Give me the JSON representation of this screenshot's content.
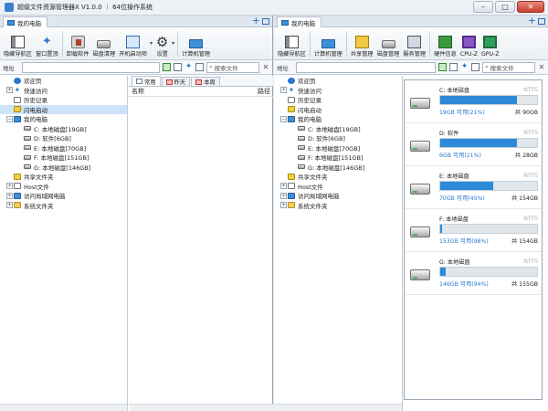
{
  "window": {
    "title": "超级文件资源管理器X V1.0.0 ｜ 64位操作系统"
  },
  "left": {
    "tab_label": "我的电脑",
    "ribbon": [
      "隐藏导航区",
      "窗口置顶",
      "卸载软件",
      "磁盘清理",
      "开机启动项",
      "设置",
      "计算机管理"
    ],
    "address_label": "地址",
    "search_placeholder": "搜索文件",
    "file_tabs": [
      "常用",
      "昨天",
      "本周"
    ],
    "columns": {
      "name": "名称",
      "path": "路径"
    }
  },
  "right": {
    "tab_label": "我的电脑",
    "ribbon": [
      "隐藏导航区",
      "计算机管理",
      "共享管理",
      "磁盘管理",
      "服务管理",
      "硬件信息",
      "CPU-Z",
      "GPU-Z"
    ],
    "address_label": "地址",
    "search_placeholder": "搜索文件"
  },
  "tree": [
    {
      "label": "欢迎页",
      "icon": "globe",
      "exp": ""
    },
    {
      "label": "快速访问",
      "icon": "star",
      "exp": "+"
    },
    {
      "label": "历史记录",
      "icon": "doc",
      "exp": ""
    },
    {
      "label": "闪电启动",
      "icon": "flash",
      "exp": ""
    },
    {
      "label": "我的电脑",
      "icon": "pc",
      "exp": "−"
    },
    {
      "label": "C: 本地磁盘[19GB]",
      "icon": "drv",
      "exp": "",
      "indent": 1
    },
    {
      "label": "D: 软件[6GB]",
      "icon": "drv",
      "exp": "",
      "indent": 1
    },
    {
      "label": "E: 本地磁盘[70GB]",
      "icon": "drv",
      "exp": "",
      "indent": 1
    },
    {
      "label": "F: 本地磁盘[151GB]",
      "icon": "drv",
      "exp": "",
      "indent": 1
    },
    {
      "label": "G: 本地磁盘[146GB]",
      "icon": "drv",
      "exp": "",
      "indent": 1
    },
    {
      "label": "共享文件夹",
      "icon": "flash",
      "exp": ""
    },
    {
      "label": "Host文件",
      "icon": "doc",
      "exp": "+"
    },
    {
      "label": "访问局域网电脑",
      "icon": "pc",
      "exp": "+"
    },
    {
      "label": "系统文件夹",
      "icon": "folder",
      "exp": "+"
    }
  ],
  "drives": [
    {
      "name": "C: 本地磁盘",
      "fs": "NTFS",
      "free": "19GB 可用(21%)",
      "total": "共 90GB",
      "used_fraction": 0.79
    },
    {
      "name": "D: 软件",
      "fs": "NTFS",
      "free": "6GB 可用(21%)",
      "total": "共 28GB",
      "used_fraction": 0.79
    },
    {
      "name": "E: 本地磁盘",
      "fs": "NTFS",
      "free": "70GB 可用(45%)",
      "total": "共 154GB",
      "used_fraction": 0.55
    },
    {
      "name": "F: 本地磁盘",
      "fs": "NTFS",
      "free": "153GB 可用(98%)",
      "total": "共 154GB",
      "used_fraction": 0.02
    },
    {
      "name": "G: 本地磁盘",
      "fs": "NTFS",
      "free": "146GB 可用(94%)",
      "total": "共 155GB",
      "used_fraction": 0.06
    }
  ]
}
